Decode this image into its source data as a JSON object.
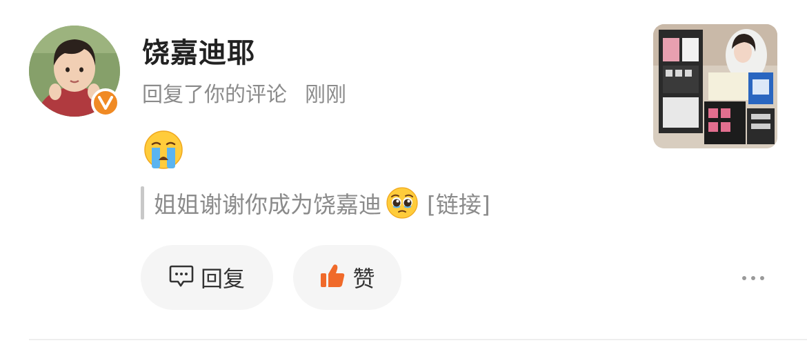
{
  "notification": {
    "username": "饶嘉迪耶",
    "action_text": "回复了你的评论",
    "time": "刚刚",
    "avatar_badge": "verified-icon",
    "reply_emoji": "crying-face-emoji",
    "quoted_comment": {
      "text": "姐姐谢谢你成为饶嘉迪",
      "emoji": "pleading-face-emoji",
      "link_label": "[链接]"
    }
  },
  "actions": {
    "reply_label": "回复",
    "like_label": "赞",
    "more_icon": "more-dots-icon"
  },
  "colors": {
    "badge": "#f08a24",
    "like_icon": "#f06a2a",
    "muted_text": "#8b8b8b",
    "button_bg": "#f5f5f5"
  }
}
